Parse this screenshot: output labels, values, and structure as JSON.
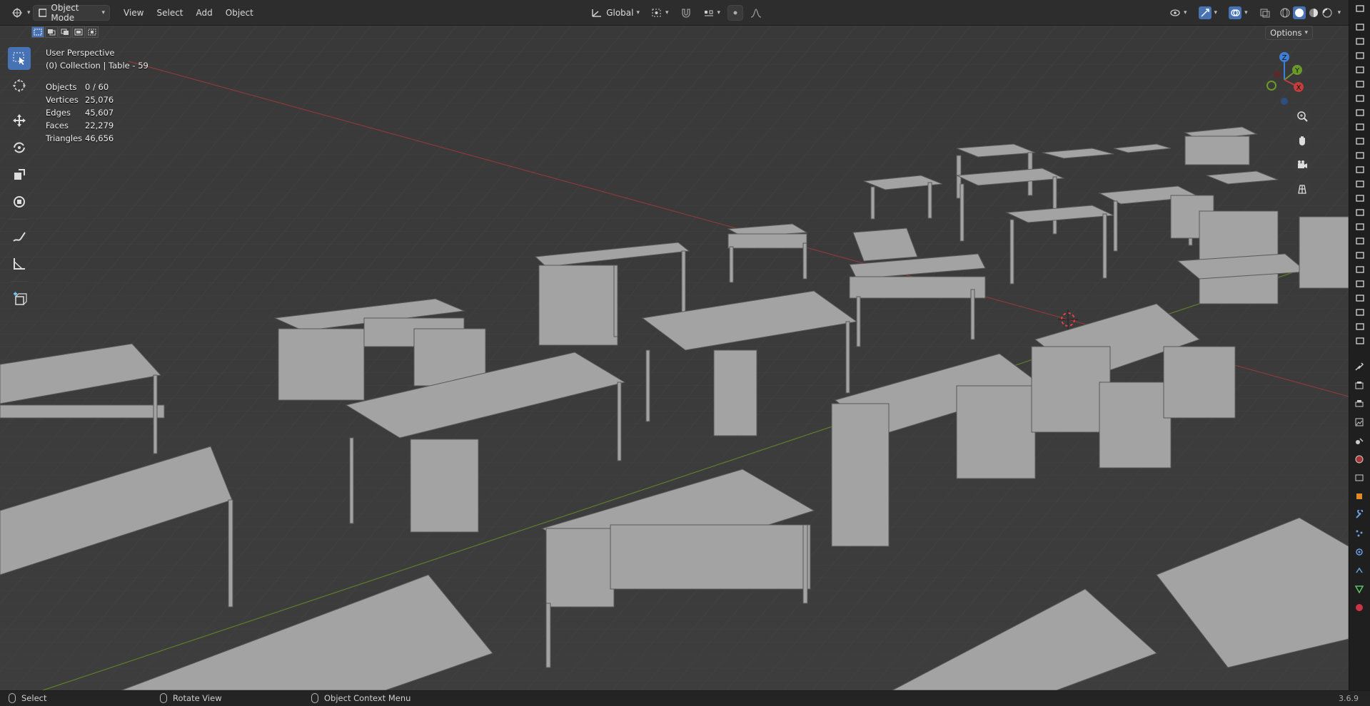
{
  "header": {
    "editor_type_icon": "3d-viewport-icon",
    "mode": "Object Mode",
    "menus": [
      "View",
      "Select",
      "Add",
      "Object"
    ],
    "transform_orientation": "Global",
    "options_label": "Options"
  },
  "overlay": {
    "view_name": "User Perspective",
    "collection_info": "(0) Collection | Table - 59",
    "stats": [
      {
        "label": "Objects",
        "value": "0 / 60"
      },
      {
        "label": "Vertices",
        "value": "25,076"
      },
      {
        "label": "Edges",
        "value": "45,607"
      },
      {
        "label": "Faces",
        "value": "22,279"
      },
      {
        "label": "Triangles",
        "value": "46,656"
      }
    ]
  },
  "gizmo": {
    "x": "X",
    "y": "Y",
    "z": "Z"
  },
  "tools": [
    "select-box-icon",
    "cursor-icon",
    "move-icon",
    "rotate-icon",
    "scale-icon",
    "transform-icon",
    "annotate-icon",
    "measure-icon",
    "add-cube-icon"
  ],
  "statusbar": {
    "left": "Select",
    "middle": "Rotate View",
    "right": "Object Context Menu",
    "version": "3.6.9"
  },
  "colors": {
    "accent": "#4772b3",
    "axis_x": "#c43c3c",
    "axis_y": "#6c9a2a",
    "axis_z": "#3f7fd6",
    "mesh": "#9a9a9a",
    "background": "#3b3b3b"
  }
}
